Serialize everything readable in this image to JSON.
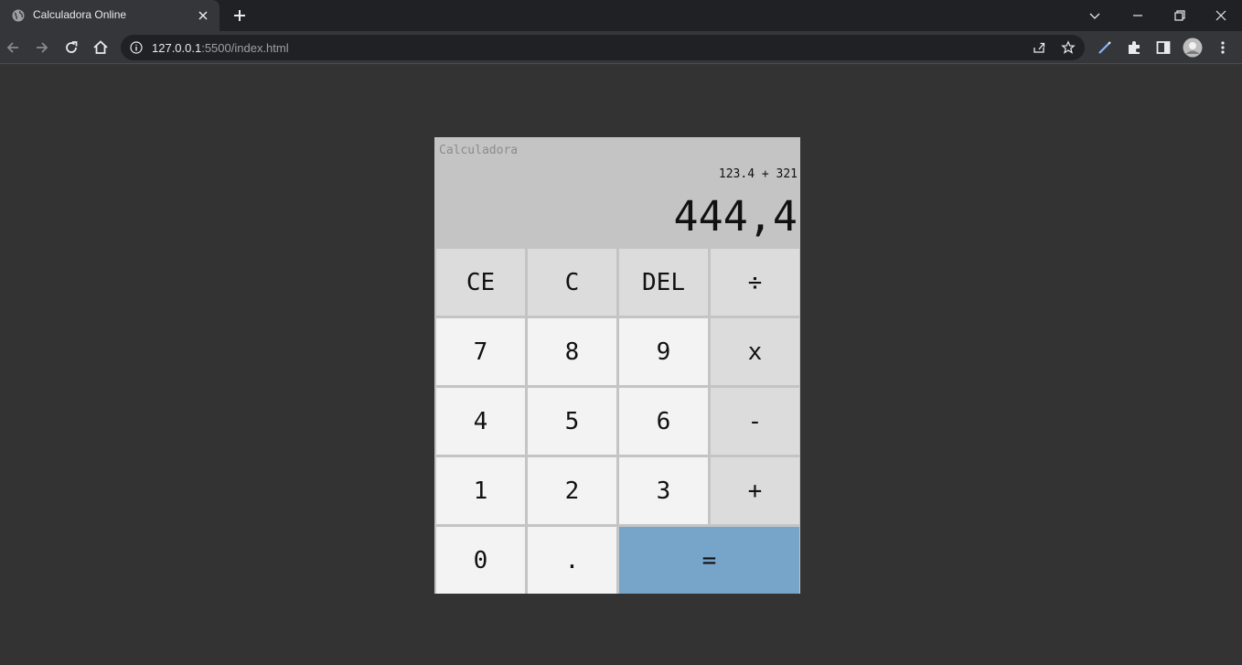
{
  "browser": {
    "tab_title": "Calculadora Online",
    "url_host": "127.0.0.1",
    "url_path": ":5500/index.html",
    "icons": {
      "favicon": "globe-icon",
      "tab_close": "close-icon",
      "new_tab": "plus-icon",
      "tab_search": "chevron-down-icon",
      "minimize": "minimize-icon",
      "restore": "restore-icon",
      "close": "close-icon",
      "back": "arrow-left-icon",
      "forward": "arrow-right-icon",
      "reload": "reload-icon",
      "home": "home-icon",
      "site_info": "info-icon",
      "share": "share-icon",
      "bookmark": "star-icon",
      "extension_pen": "pen-icon",
      "extensions": "puzzle-icon",
      "side_panel": "side-panel-icon",
      "profile": "avatar",
      "menu": "more-vert-icon"
    }
  },
  "calculator": {
    "title": "Calculadora",
    "expression": "123.4 + 321",
    "result": "444,4",
    "keys": [
      {
        "label": "CE",
        "type": "fn",
        "name": "clear-entry-button"
      },
      {
        "label": "C",
        "type": "fn",
        "name": "clear-button"
      },
      {
        "label": "DEL",
        "type": "fn",
        "name": "delete-button"
      },
      {
        "label": "÷",
        "type": "fn",
        "name": "divide-button"
      },
      {
        "label": "7",
        "type": "num",
        "name": "digit-7-button"
      },
      {
        "label": "8",
        "type": "num",
        "name": "digit-8-button"
      },
      {
        "label": "9",
        "type": "num",
        "name": "digit-9-button"
      },
      {
        "label": "x",
        "type": "fn",
        "name": "multiply-button"
      },
      {
        "label": "4",
        "type": "num",
        "name": "digit-4-button"
      },
      {
        "label": "5",
        "type": "num",
        "name": "digit-5-button"
      },
      {
        "label": "6",
        "type": "num",
        "name": "digit-6-button"
      },
      {
        "label": "-",
        "type": "fn",
        "name": "subtract-button"
      },
      {
        "label": "1",
        "type": "num",
        "name": "digit-1-button"
      },
      {
        "label": "2",
        "type": "num",
        "name": "digit-2-button"
      },
      {
        "label": "3",
        "type": "num",
        "name": "digit-3-button"
      },
      {
        "label": "+",
        "type": "fn",
        "name": "add-button"
      },
      {
        "label": "0",
        "type": "num",
        "name": "digit-0-button"
      },
      {
        "label": ".",
        "type": "num",
        "name": "decimal-point-button"
      },
      {
        "label": "=",
        "type": "eq",
        "name": "equals-button"
      }
    ],
    "colors": {
      "background": "#c4c4c4",
      "function_key": "#dcdcdc",
      "number_key": "#f3f3f3",
      "equals_key": "#77a5ca",
      "page_background": "#333333"
    }
  }
}
